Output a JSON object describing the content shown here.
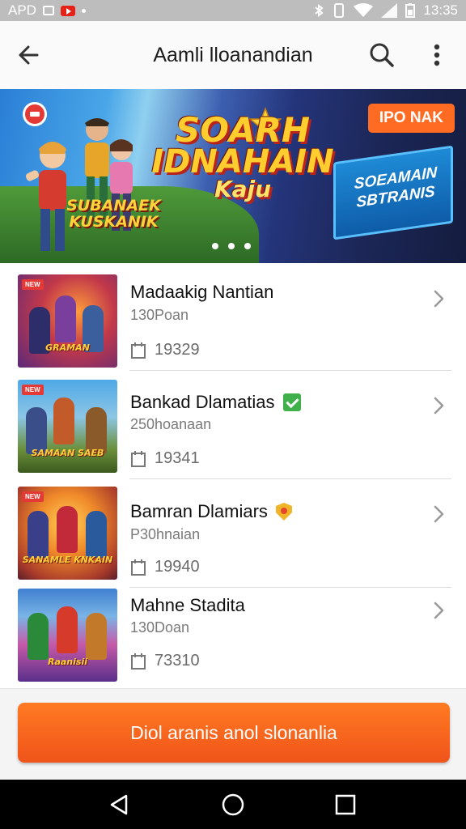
{
  "status_bar": {
    "left_text": "APD",
    "time": "13:35"
  },
  "app_bar": {
    "title": "Aamli lloanandian",
    "icons": {
      "back": "arrow-back-icon",
      "search": "search-icon",
      "more": "more-vert-icon"
    }
  },
  "banner": {
    "title_line1": "SOARH",
    "title_line2": "IDNAHAIN",
    "title_line3": "Kaju",
    "subtitle": "SUBANAEK KUSKANIK",
    "tag": "IPO NAK",
    "panel_text": "SOEAMAIN SBTRANIS",
    "page_dots": 3
  },
  "list": {
    "items": [
      {
        "name": "Madaakig Nantian",
        "subtitle": "130Poan",
        "count": "19329",
        "badge": null,
        "thumb_tag": "NEW",
        "thumb_text": "GRAMAN"
      },
      {
        "name": "Bankad Dlamatias",
        "subtitle": "250hoanaan",
        "count": "19341",
        "badge": "check-badge-icon",
        "thumb_tag": "NEW",
        "thumb_text": "SAMAAN SAEB"
      },
      {
        "name": "Bamran Dlamiars",
        "subtitle": "P30hnaian",
        "count": "19940",
        "badge": "shield-badge-icon",
        "thumb_tag": "NEW",
        "thumb_text": "SANAMLE KNKAIN"
      },
      {
        "name": "Mahne Stadita",
        "subtitle": "130Doan",
        "count": "73310",
        "badge": null,
        "thumb_tag": "",
        "thumb_text": "Raanisii"
      }
    ]
  },
  "cta": {
    "label": "Diol aranis anol slonanlia"
  },
  "colors": {
    "accent": "#f26322",
    "check_badge": "#3fb04a",
    "shield_badge": "#f0b429"
  }
}
